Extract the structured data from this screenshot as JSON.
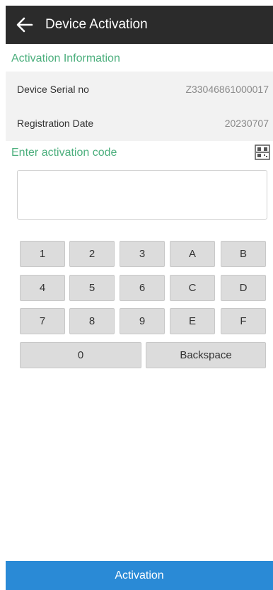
{
  "header": {
    "title": "Device Activation",
    "back_icon": "arrow-left-icon"
  },
  "activation_info": {
    "section_title": "Activation Information",
    "rows": [
      {
        "label": "Device Serial no",
        "value": "Z33046861000017"
      },
      {
        "label": "Registration Date",
        "value": "20230707"
      }
    ]
  },
  "code_entry": {
    "section_title": "Enter activation code",
    "scan_icon": "qr-scan-icon",
    "value": "",
    "placeholder": ""
  },
  "keypad": {
    "keys": [
      "1",
      "2",
      "3",
      "A",
      "B",
      "4",
      "5",
      "6",
      "C",
      "D",
      "7",
      "8",
      "9",
      "E",
      "F"
    ],
    "zero_label": "0",
    "backspace_label": "Backspace"
  },
  "activation_button": {
    "label": "Activation"
  },
  "colors": {
    "app_bar": "#2b2b2b",
    "section_text": "#4caf7d",
    "row_background": "#f2f2f2",
    "key_background": "#dcdcdc",
    "primary_button": "#2a8ad6"
  }
}
